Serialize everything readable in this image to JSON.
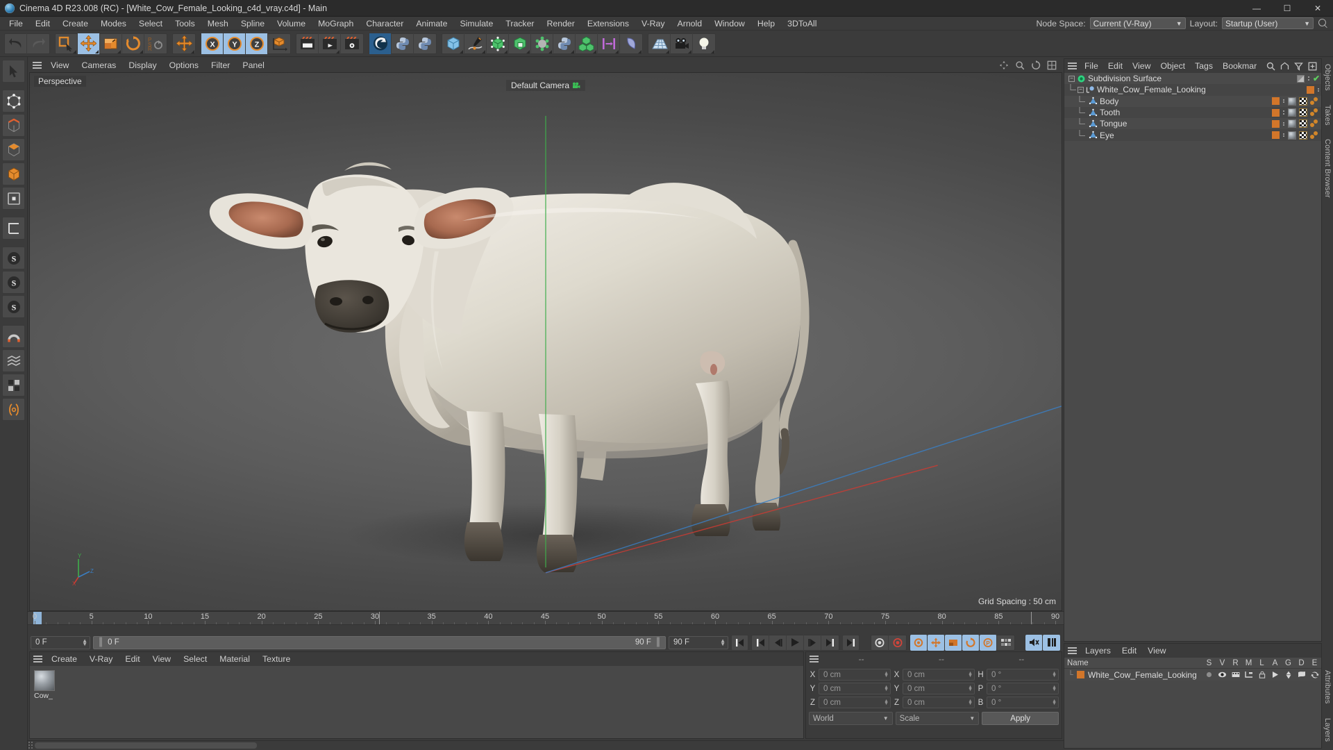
{
  "window": {
    "title": "Cinema 4D R23.008 (RC) - [White_Cow_Female_Looking_c4d_vray.c4d] - Main",
    "app_icon": "cinema4d-logo-icon",
    "minimize": "—",
    "maximize": "☐",
    "close": "✕"
  },
  "menubar": {
    "items": [
      "File",
      "Edit",
      "Create",
      "Modes",
      "Select",
      "Tools",
      "Mesh",
      "Spline",
      "Volume",
      "MoGraph",
      "Character",
      "Animate",
      "Simulate",
      "Tracker",
      "Render",
      "Extensions",
      "V-Ray",
      "Arnold",
      "Window",
      "Help",
      "3DToAll"
    ],
    "node_space_label": "Node Space:",
    "node_space_value": "Current (V-Ray)",
    "layout_label": "Layout:",
    "layout_value": "Startup (User)",
    "search_icon": "search-icon"
  },
  "toolbar": {
    "groups": [
      {
        "name": "history",
        "buttons": [
          {
            "name": "undo-button",
            "icon": "undo-arrow-icon",
            "state": "normal"
          },
          {
            "name": "redo-button",
            "icon": "redo-arrow-icon",
            "state": "disabled"
          }
        ]
      },
      {
        "name": "transform",
        "buttons": [
          {
            "name": "select-tool-button",
            "icon": "selection-cursor-icon",
            "state": "normal"
          },
          {
            "name": "move-tool-button",
            "icon": "move-arrows-icon",
            "state": "active"
          },
          {
            "name": "scale-tool-button",
            "icon": "scale-box-icon",
            "state": "normal"
          },
          {
            "name": "rotate-tool-button",
            "icon": "rotate-circle-icon",
            "state": "normal"
          },
          {
            "name": "psr-lock-button",
            "icon": "psr-icon",
            "state": "normal"
          }
        ]
      },
      {
        "name": "move-dup",
        "buttons": [
          {
            "name": "move-duplicate-button",
            "icon": "move-arrows-icon",
            "state": "normal"
          }
        ]
      },
      {
        "name": "axis-lock",
        "buttons": [
          {
            "name": "x-axis-lock-button",
            "icon": "x-axis-icon",
            "state": "active"
          },
          {
            "name": "y-axis-lock-button",
            "icon": "y-axis-icon",
            "state": "active"
          },
          {
            "name": "z-axis-lock-button",
            "icon": "z-axis-icon",
            "state": "active"
          },
          {
            "name": "world-object-coord-button",
            "icon": "world-coord-cube-icon",
            "state": "normal"
          }
        ]
      },
      {
        "name": "render",
        "buttons": [
          {
            "name": "render-view-button",
            "icon": "render-clapper-icon",
            "state": "normal"
          },
          {
            "name": "render-to-picture-viewer-button",
            "icon": "render-play-clapper-icon",
            "state": "normal"
          },
          {
            "name": "render-settings-button",
            "icon": "render-gear-clapper-icon",
            "state": "normal"
          }
        ]
      },
      {
        "name": "plugins-1",
        "buttons": [
          {
            "name": "vray-button",
            "icon": "vray-logo-icon",
            "state": "brand"
          },
          {
            "name": "python-button-1",
            "icon": "python-logo-icon",
            "state": "normal"
          },
          {
            "name": "python-button-2",
            "icon": "python-logo-icon",
            "state": "normal"
          }
        ]
      },
      {
        "name": "primitives",
        "buttons": [
          {
            "name": "add-cube-button",
            "icon": "blue-cube-icon",
            "state": "normal"
          },
          {
            "name": "add-spline-button",
            "icon": "pen-spline-icon",
            "state": "normal"
          },
          {
            "name": "hyper-nurbs-button",
            "icon": "subdivision-cube-icon",
            "state": "normal"
          },
          {
            "name": "generator-button",
            "icon": "green-cube-icon",
            "state": "normal"
          },
          {
            "name": "deformer-button",
            "icon": "deformer-atom-icon",
            "state": "normal"
          },
          {
            "name": "python-generator-button",
            "icon": "python-logo-icon",
            "state": "normal"
          },
          {
            "name": "array-button",
            "icon": "green-cubes-array-icon",
            "state": "normal"
          },
          {
            "name": "align-button",
            "icon": "align-bars-icon",
            "state": "normal"
          },
          {
            "name": "field-button",
            "icon": "field-shape-icon",
            "state": "normal"
          }
        ]
      },
      {
        "name": "scene",
        "buttons": [
          {
            "name": "add-floor-button",
            "icon": "grid-floor-icon",
            "state": "normal"
          },
          {
            "name": "add-camera-button",
            "icon": "camera-icon",
            "state": "normal"
          },
          {
            "name": "add-light-button",
            "icon": "lightbulb-icon",
            "state": "normal"
          }
        ]
      }
    ]
  },
  "left_palette": {
    "buttons": [
      {
        "name": "live-selection-tool",
        "icon": "arrow-cursor-icon"
      },
      {
        "name": "point-mode-tool",
        "icon": "point-mode-icon"
      },
      {
        "name": "edge-mode-tool",
        "icon": "edge-mode-icon"
      },
      {
        "name": "polygon-mode-tool",
        "icon": "polygon-mode-icon"
      },
      {
        "name": "model-mode-tool",
        "icon": "model-mode-icon"
      },
      {
        "name": "object-axis-tool",
        "icon": "object-axis-icon"
      },
      {
        "name": "texture-axis-tool",
        "icon": "texture-axis-icon"
      },
      {
        "name": "enable-axis-tool",
        "icon": "axis-L-icon"
      },
      {
        "name": "workplane-tool",
        "icon": "workplane-S-icon"
      },
      {
        "name": "workplane-lock-tool",
        "icon": "workplane-S-lock-icon"
      },
      {
        "name": "workplane-snap-tool",
        "icon": "workplane-S-snap-icon"
      },
      {
        "name": "snap-magnet-tool",
        "icon": "magnet-snap-icon"
      },
      {
        "name": "quantize-tool",
        "icon": "quantize-icon"
      },
      {
        "name": "viewport-solo-tool",
        "icon": "solo-grid-icon"
      },
      {
        "name": "uv-tool",
        "icon": "uv-brackets-icon"
      }
    ]
  },
  "viewport": {
    "menu": [
      "View",
      "Cameras",
      "Display",
      "Options",
      "Filter",
      "Panel"
    ],
    "view_label": "Perspective",
    "camera_label": "Default Camera",
    "camera_icon": "camera-small-icon",
    "grid_spacing": "Grid Spacing : 50 cm",
    "axis_labels": {
      "x": "X",
      "y": "Y",
      "z": "Z"
    },
    "header_icons": [
      "pan-view-icon",
      "zoom-view-icon",
      "rotate-view-icon",
      "maximize-view-icon"
    ],
    "subject": "white brahman cow 3d model"
  },
  "timeline": {
    "ticks": [
      0,
      5,
      10,
      15,
      20,
      25,
      30,
      35,
      40,
      45,
      50,
      55,
      60,
      65,
      70,
      75,
      80,
      85,
      90
    ],
    "current_frame_marker": "0",
    "start_frame_field": "0 F",
    "preview_min_field": "0 F",
    "preview_max_field": "90 F",
    "end_frame_field": "90 F",
    "transport": [
      {
        "name": "go-to-start-button",
        "icon": "skip-start-icon"
      },
      {
        "name": "go-to-previous-keyframe-button",
        "icon": "prev-key-icon"
      },
      {
        "name": "go-to-previous-frame-button",
        "icon": "step-back-icon"
      },
      {
        "name": "play-button",
        "icon": "play-icon"
      },
      {
        "name": "go-to-next-frame-button",
        "icon": "step-forward-icon"
      },
      {
        "name": "go-to-next-keyframe-button",
        "icon": "next-key-icon"
      },
      {
        "name": "go-to-end-button",
        "icon": "skip-end-icon"
      }
    ],
    "record_tools": [
      {
        "name": "record-active-objects-button",
        "icon": "record-circle-icon",
        "state": "normal"
      },
      {
        "name": "autokeying-button",
        "icon": "autokey-red-icon",
        "state": "normal"
      },
      {
        "name": "keyframe-selection-button",
        "icon": "key-selection-icon",
        "state": "active"
      },
      {
        "name": "position-key-button",
        "icon": "position-key-icon",
        "state": "active"
      },
      {
        "name": "scale-key-button",
        "icon": "scale-key-icon",
        "state": "active"
      },
      {
        "name": "rotation-key-button",
        "icon": "rotation-key-icon",
        "state": "active"
      },
      {
        "name": "parameter-key-button",
        "icon": "param-key-icon",
        "state": "active"
      },
      {
        "name": "point-level-animation-button",
        "icon": "pla-icon",
        "state": "normal"
      }
    ],
    "sound_tools": [
      {
        "name": "mute-sound-button",
        "icon": "speaker-mute-icon",
        "state": "active"
      },
      {
        "name": "timeline-layout-button",
        "icon": "timeline-bars-icon",
        "state": "active"
      }
    ]
  },
  "material_manager": {
    "menu": [
      "Create",
      "V-Ray",
      "Edit",
      "View",
      "Select",
      "Material",
      "Texture"
    ],
    "materials": [
      {
        "name": "Cow_",
        "preview": "sphere-preview"
      }
    ]
  },
  "coordinate_manager": {
    "header_dots": [
      "--",
      "--",
      "--"
    ],
    "rows": [
      {
        "pos_label": "X",
        "pos_value": "0 cm",
        "size_label": "X",
        "size_value": "0 cm",
        "rot_label": "H",
        "rot_value": "0 °"
      },
      {
        "pos_label": "Y",
        "pos_value": "0 cm",
        "size_label": "Y",
        "size_value": "0 cm",
        "rot_label": "P",
        "rot_value": "0 °"
      },
      {
        "pos_label": "Z",
        "pos_value": "0 cm",
        "size_label": "Z",
        "size_value": "0 cm",
        "rot_label": "B",
        "rot_value": "0 °"
      }
    ],
    "coord_system": "World",
    "mode": "Scale",
    "apply_label": "Apply"
  },
  "object_manager": {
    "menu": [
      "File",
      "Edit",
      "View",
      "Object",
      "Tags",
      "Bookmar"
    ],
    "header_icons": [
      "search-icon",
      "home-icon",
      "filter-funnel-icon",
      "add-box-icon"
    ],
    "rows": [
      {
        "name": "Subdivision Surface",
        "indent": 0,
        "icon": "subdivision-surface-icon",
        "has_expander": true,
        "chip": "gray",
        "tags": [],
        "check": true
      },
      {
        "name": "White_Cow_Female_Looking",
        "indent": 1,
        "icon": "null-object-icon",
        "has_expander": true,
        "chip": "orange",
        "tags": [],
        "check": false
      },
      {
        "name": "Body",
        "indent": 2,
        "icon": "polygon-object-icon",
        "has_expander": false,
        "chip": "orange",
        "tags": [
          "material-tag",
          "uvw-tag",
          "phong-tag"
        ],
        "check": false
      },
      {
        "name": "Tooth",
        "indent": 2,
        "icon": "polygon-object-icon",
        "has_expander": false,
        "chip": "orange",
        "tags": [
          "material-tag",
          "uvw-tag",
          "phong-tag"
        ],
        "check": false
      },
      {
        "name": "Tongue",
        "indent": 2,
        "icon": "polygon-object-icon",
        "has_expander": false,
        "chip": "orange",
        "tags": [
          "material-tag",
          "uvw-tag",
          "phong-tag"
        ],
        "check": false
      },
      {
        "name": "Eye",
        "indent": 2,
        "icon": "polygon-object-icon",
        "has_expander": false,
        "chip": "orange",
        "tags": [
          "material-tag",
          "uvw-tag",
          "phong-tag"
        ],
        "check": false
      }
    ]
  },
  "layers_manager": {
    "menu": [
      "Layers",
      "Edit",
      "View"
    ],
    "columns": [
      "Name",
      "S",
      "V",
      "R",
      "M",
      "L",
      "A",
      "G",
      "D",
      "E"
    ],
    "rows": [
      {
        "name": "White_Cow_Female_Looking",
        "color": "#d2762a",
        "flags": [
          "solo-dot-icon",
          "visible-eye-icon",
          "render-film-icon",
          "manager-icon",
          "lock-icon",
          "animation-play-icon",
          "generator-icon",
          "deformer-icon",
          "expression-icon"
        ]
      }
    ]
  },
  "right_tabs": {
    "top": [
      "Objects",
      "Takes",
      "Content Browser"
    ],
    "bottom": [
      "Attributes",
      "Layers"
    ]
  },
  "colors": {
    "window_bg": "#3b3b3b",
    "panel_bg": "#4a4a4a",
    "titlebar_bg": "#2b2b2b",
    "accent_blue": "#9cc0e4",
    "orange_chip": "#d2762a",
    "green_check": "#5fcf5f",
    "axis_x": "#c0392b",
    "axis_y": "#27ae60",
    "axis_z": "#2980b9"
  }
}
